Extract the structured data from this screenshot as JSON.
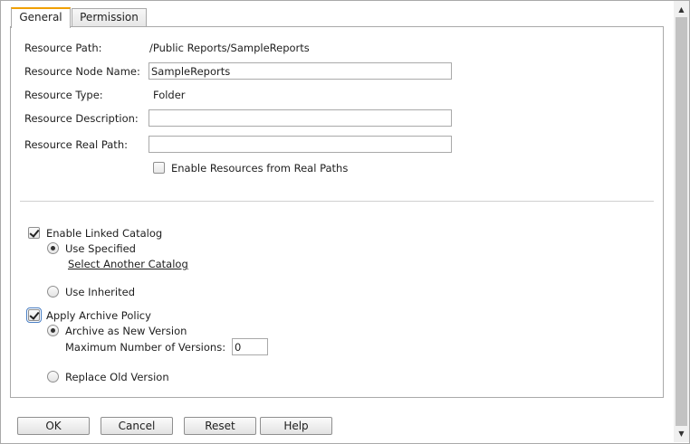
{
  "tabs": [
    {
      "label": "General"
    },
    {
      "label": "Permission"
    }
  ],
  "general": {
    "resource_path_label": "Resource Path:",
    "resource_path_value": "/Public Reports/SampleReports",
    "node_name_label": "Resource Node Name:",
    "node_name_value": "SampleReports",
    "type_label": "Resource Type:",
    "type_value": "Folder",
    "description_label": "Resource Description:",
    "description_value": "",
    "real_path_label": "Resource Real Path:",
    "real_path_value": "",
    "enable_real_paths_label": "Enable Resources from Real Paths",
    "enable_real_paths_checked": false
  },
  "catalog": {
    "enable_label": "Enable Linked Catalog",
    "enable_checked": true,
    "use_specified_label": "Use Specified",
    "use_specified_selected": true,
    "select_another_label": "Select Another Catalog",
    "use_inherited_label": "Use Inherited",
    "use_inherited_selected": false
  },
  "archive": {
    "apply_label": "Apply Archive Policy",
    "apply_checked": true,
    "new_version_label": "Archive as New Version",
    "new_version_selected": true,
    "max_versions_label": "Maximum Number of Versions:",
    "max_versions_value": "0",
    "replace_label": "Replace Old Version",
    "replace_selected": false
  },
  "buttons": {
    "ok": "OK",
    "cancel": "Cancel",
    "reset": "Reset",
    "help": "Help"
  },
  "scrollbar": {
    "up_icon": "▲",
    "down_icon": "▼"
  }
}
